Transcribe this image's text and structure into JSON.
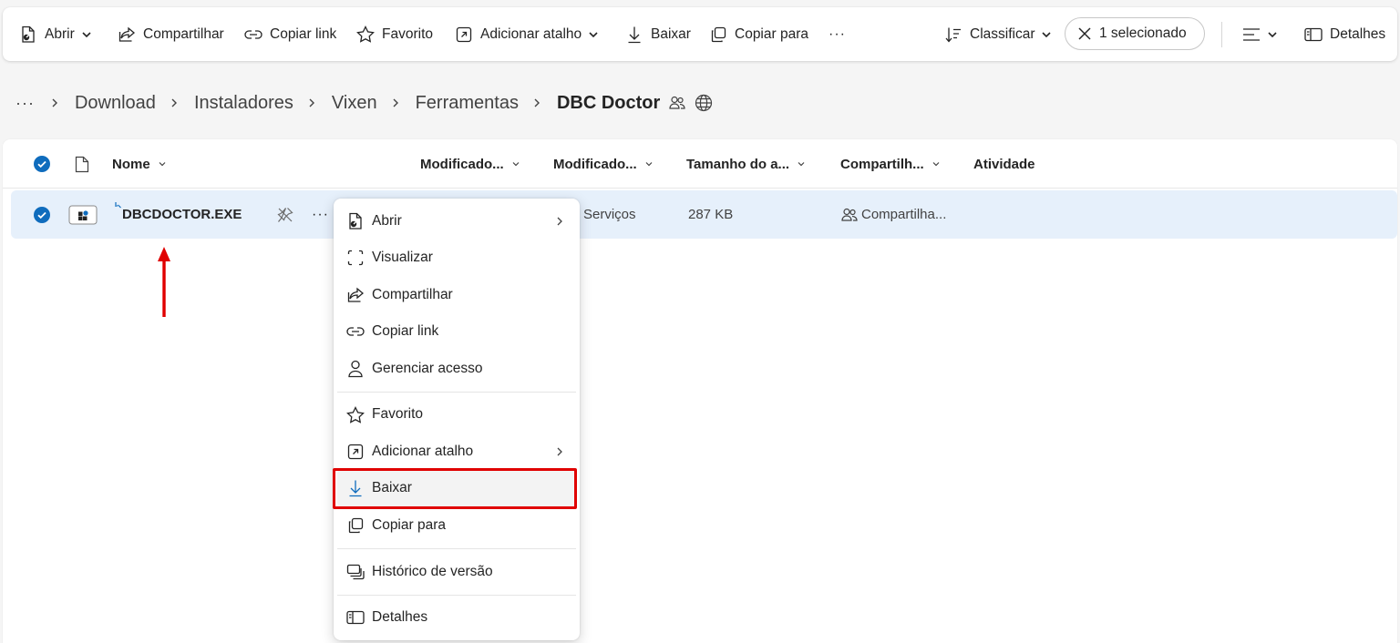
{
  "toolbar": {
    "open_label": "Abrir",
    "share_label": "Compartilhar",
    "copy_link_label": "Copiar link",
    "favorite_label": "Favorito",
    "add_shortcut_label": "Adicionar atalho",
    "download_label": "Baixar",
    "copy_to_label": "Copiar para",
    "more_label": "···",
    "sort_label": "Classificar",
    "selection_label": "1 selecionado",
    "details_label": "Detalhes"
  },
  "breadcrumb": {
    "more": "···",
    "items": [
      "Download",
      "Instaladores",
      "Vixen",
      "Ferramentas"
    ],
    "current": "DBC Doctor"
  },
  "columns": {
    "name": "Nome",
    "modified": "Modificado...",
    "modified_by": "Modificado...",
    "size": "Tamanho do a...",
    "sharing": "Compartilh...",
    "activity": "Atividade"
  },
  "rows": [
    {
      "name": "DBCDOCTOR.EXE",
      "modified_by": "Serviços",
      "size": "287 KB",
      "sharing": "Compartilha...",
      "selected": true
    }
  ],
  "context_menu": {
    "items": [
      {
        "label": "Abrir",
        "icon": "open-icon",
        "submenu": true
      },
      {
        "label": "Visualizar",
        "icon": "preview-icon"
      },
      {
        "label": "Compartilhar",
        "icon": "share-icon"
      },
      {
        "label": "Copiar link",
        "icon": "link-icon"
      },
      {
        "label": "Gerenciar acesso",
        "icon": "person-icon"
      },
      {
        "label": "Favorito",
        "icon": "star-icon"
      },
      {
        "label": "Adicionar atalho",
        "icon": "shortcut-icon",
        "submenu": true
      },
      {
        "label": "Baixar",
        "icon": "download-icon",
        "highlighted": true
      },
      {
        "label": "Copiar para",
        "icon": "copy-icon"
      },
      {
        "label": "Histórico de versão",
        "icon": "history-icon"
      },
      {
        "label": "Detalhes",
        "icon": "details-icon"
      }
    ]
  },
  "colors": {
    "accent": "#0f6cbd",
    "selected_row": "#e6f0fb",
    "annotation": "#e00000"
  }
}
